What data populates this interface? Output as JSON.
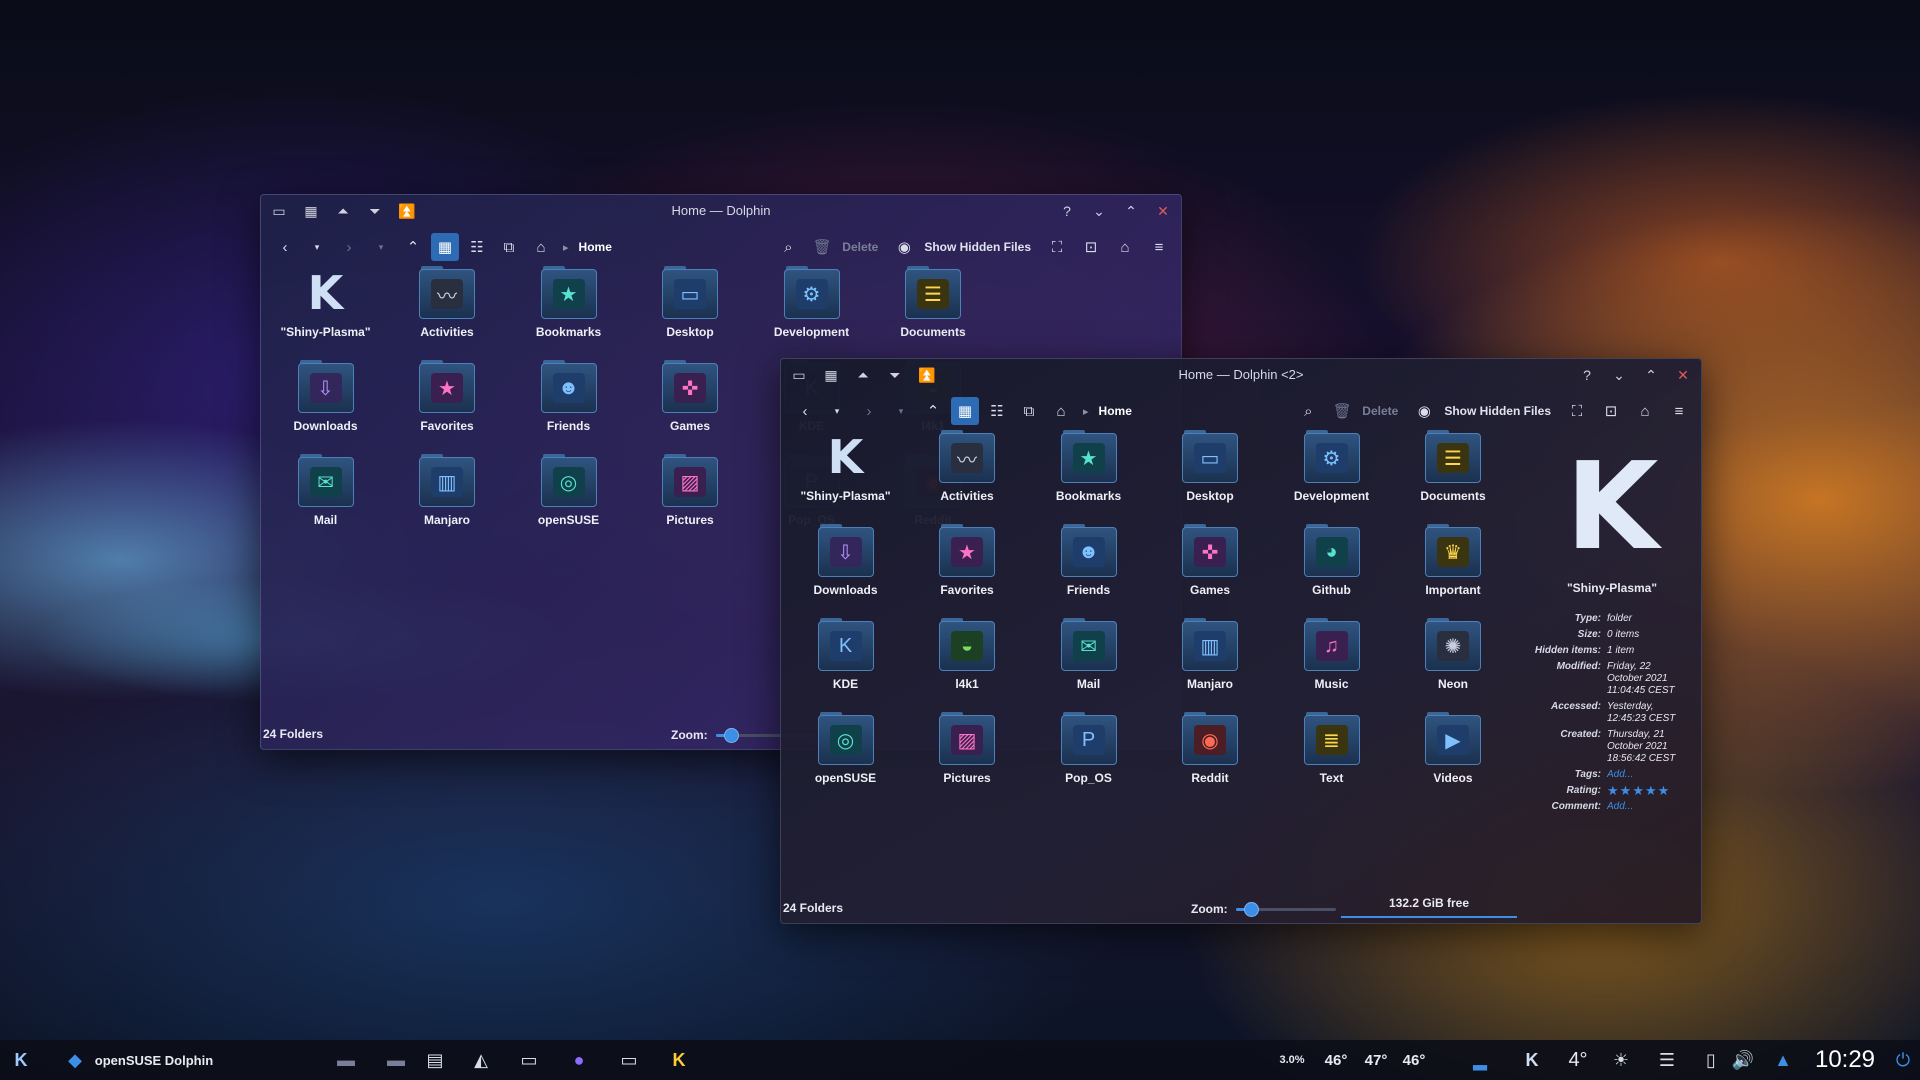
{
  "colors": {
    "accent": "#3d8ee6",
    "close": "#e05a5a",
    "taskbar": "#0c0e18"
  },
  "window1": {
    "title": "Home — Dolphin",
    "breadcrumb": "Home",
    "delete_label": "Delete",
    "show_hidden_label": "Show Hidden Files",
    "status": "24 Folders",
    "zoom_label": "Zoom:",
    "zoom_level": 0.15,
    "items": [
      {
        "label": "\"Shiny-Plasma\"",
        "icon": "kde-logo-icon",
        "color": "gray"
      },
      {
        "label": "Activities",
        "icon": "activity-icon",
        "color": "gray"
      },
      {
        "label": "Bookmarks",
        "icon": "bookmark-icon",
        "color": "teal"
      },
      {
        "label": "Desktop",
        "icon": "desktop-icon",
        "color": "blue"
      },
      {
        "label": "Development",
        "icon": "gear-icon",
        "color": "blue"
      },
      {
        "label": "Documents",
        "icon": "document-icon",
        "color": "yel"
      },
      {
        "label": "Downloads",
        "icon": "download-arrow-icon",
        "color": "vio"
      },
      {
        "label": "Favorites",
        "icon": "star-icon",
        "color": "pink"
      },
      {
        "label": "Friends",
        "icon": "people-icon",
        "color": "blue"
      },
      {
        "label": "Games",
        "icon": "gamepad-icon",
        "color": "pink"
      },
      {
        "label": "KDE",
        "icon": "kde-gear-icon",
        "color": "blue"
      },
      {
        "label": "l4k1",
        "icon": "chameleon-icon",
        "color": "grn"
      },
      {
        "label": "Mail",
        "icon": "mail-icon",
        "color": "teal"
      },
      {
        "label": "Manjaro",
        "icon": "manjaro-icon",
        "color": "blue"
      },
      {
        "label": "openSUSE",
        "icon": "opensuse-icon",
        "color": "teal"
      },
      {
        "label": "Pictures",
        "icon": "picture-icon",
        "color": "pink"
      },
      {
        "label": "Pop_OS",
        "icon": "popos-icon",
        "color": "blue"
      },
      {
        "label": "Reddit",
        "icon": "reddit-icon",
        "color": "red"
      }
    ]
  },
  "window2": {
    "title": "Home — Dolphin <2>",
    "breadcrumb": "Home",
    "delete_label": "Delete",
    "show_hidden_label": "Show Hidden Files",
    "status": "24 Folders",
    "zoom_label": "Zoom:",
    "zoom_level": 0.15,
    "free_space": "132.2 GiB free",
    "items": [
      {
        "label": "\"Shiny-Plasma\"",
        "icon": "kde-logo-icon",
        "color": "gray"
      },
      {
        "label": "Activities",
        "icon": "activity-icon",
        "color": "gray"
      },
      {
        "label": "Bookmarks",
        "icon": "bookmark-icon",
        "color": "teal"
      },
      {
        "label": "Desktop",
        "icon": "desktop-icon",
        "color": "blue"
      },
      {
        "label": "Development",
        "icon": "gear-icon",
        "color": "blue"
      },
      {
        "label": "Documents",
        "icon": "document-icon",
        "color": "yel"
      },
      {
        "label": "Downloads",
        "icon": "download-arrow-icon",
        "color": "vio"
      },
      {
        "label": "Favorites",
        "icon": "star-icon",
        "color": "pink"
      },
      {
        "label": "Friends",
        "icon": "people-icon",
        "color": "blue"
      },
      {
        "label": "Games",
        "icon": "gamepad-icon",
        "color": "pink"
      },
      {
        "label": "Github",
        "icon": "github-icon",
        "color": "teal"
      },
      {
        "label": "Important",
        "icon": "trophy-icon",
        "color": "yel"
      },
      {
        "label": "KDE",
        "icon": "kde-gear-icon",
        "color": "blue"
      },
      {
        "label": "l4k1",
        "icon": "chameleon-icon",
        "color": "grn"
      },
      {
        "label": "Mail",
        "icon": "mail-icon",
        "color": "teal"
      },
      {
        "label": "Manjaro",
        "icon": "manjaro-icon",
        "color": "blue"
      },
      {
        "label": "Music",
        "icon": "music-note-icon",
        "color": "pink"
      },
      {
        "label": "Neon",
        "icon": "neon-icon",
        "color": "gray"
      },
      {
        "label": "openSUSE",
        "icon": "opensuse-icon",
        "color": "teal"
      },
      {
        "label": "Pictures",
        "icon": "picture-icon",
        "color": "pink"
      },
      {
        "label": "Pop_OS",
        "icon": "popos-icon",
        "color": "blue"
      },
      {
        "label": "Reddit",
        "icon": "reddit-icon",
        "color": "red"
      },
      {
        "label": "Text",
        "icon": "text-file-icon",
        "color": "yel"
      },
      {
        "label": "Videos",
        "icon": "video-icon",
        "color": "blue"
      }
    ],
    "info_panel": {
      "name": "\"Shiny-Plasma\"",
      "rows": [
        {
          "key": "Type:",
          "value": "folder"
        },
        {
          "key": "Size:",
          "value": "0 items"
        },
        {
          "key": "Hidden items:",
          "value": "1 item"
        },
        {
          "key": "Modified:",
          "value": "Friday, 22 October 2021 11:04:45 CEST"
        },
        {
          "key": "Accessed:",
          "value": "Yesterday, 12:45:23 CEST"
        },
        {
          "key": "Created:",
          "value": "Thursday, 21 October 2021 18:56:42 CEST"
        }
      ],
      "tags_label": "Tags:",
      "tags_value": "Add...",
      "rating_label": "Rating:",
      "rating": 5,
      "comment_label": "Comment:",
      "comment_value": "Add..."
    }
  },
  "taskbar": {
    "distro_label": "openSUSE",
    "app_label": "Dolphin",
    "cpu": "3.0%",
    "temp1": "46°",
    "temp2": "47°",
    "temp3": "46°",
    "weather": "4°",
    "clock": "10:29"
  }
}
